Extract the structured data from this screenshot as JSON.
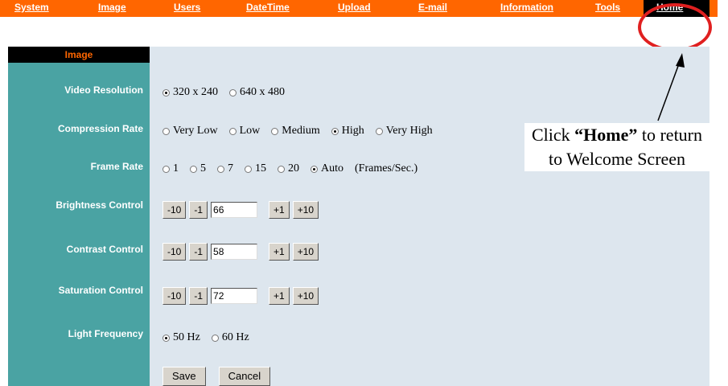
{
  "nav": {
    "items": [
      "System",
      "Image",
      "Users",
      "DateTime",
      "Upload",
      "E-mail",
      "Information",
      "Tools"
    ],
    "home": "Home"
  },
  "sidebar": {
    "title": "Image",
    "labels": {
      "video_resolution": "Video Resolution",
      "compression_rate": "Compression Rate",
      "frame_rate": "Frame Rate",
      "brightness": "Brightness Control",
      "contrast": "Contrast Control",
      "saturation": "Saturation Control",
      "light_frequency": "Light Frequency"
    }
  },
  "video_resolution": {
    "options": [
      "320 x 240",
      "640 x 480"
    ],
    "selected": "320 x 240"
  },
  "compression_rate": {
    "options": [
      "Very Low",
      "Low",
      "Medium",
      "High",
      "Very High"
    ],
    "selected": "High"
  },
  "frame_rate": {
    "options": [
      "1",
      "5",
      "7",
      "15",
      "20",
      "Auto"
    ],
    "selected": "Auto",
    "unit": "(Frames/Sec.)"
  },
  "adjust_buttons": {
    "minus10": "-10",
    "minus1": "-1",
    "plus1": "+1",
    "plus10": "+10"
  },
  "brightness": {
    "value": "66"
  },
  "contrast": {
    "value": "58"
  },
  "saturation": {
    "value": "72"
  },
  "light_frequency": {
    "options": [
      "50 Hz",
      "60 Hz"
    ],
    "selected": "50 Hz"
  },
  "actions": {
    "save": "Save",
    "cancel": "Cancel"
  },
  "callout": {
    "pre": "Click ",
    "bold": "“Home”",
    "post": " to return to Welcome Screen"
  },
  "colors": {
    "nav": "#ff6600",
    "sidebar": "#4aa3a3",
    "main": "#dde6ee",
    "highlight": "#e02020"
  }
}
